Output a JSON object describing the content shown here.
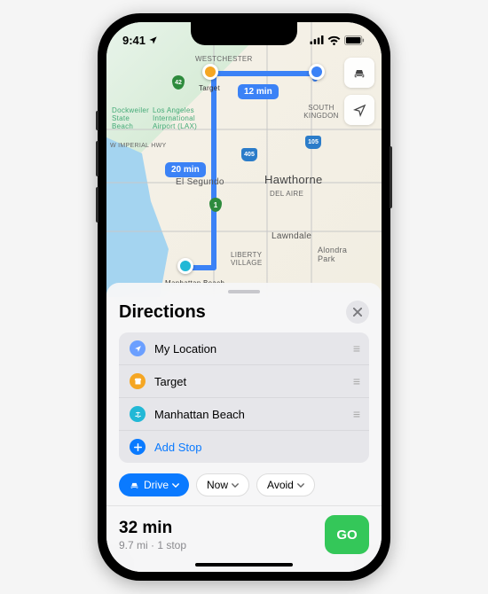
{
  "status": {
    "time": "9:41",
    "location_tracking": true
  },
  "map": {
    "route_badges": {
      "leg1": "12 min",
      "leg2": "20 min"
    },
    "stops": {
      "start_label": "Target",
      "end_label": "Manhattan Beach"
    },
    "city_labels": {
      "hawthorne": "Hawthorne",
      "del_aire": "DEL AIRE",
      "el_segundo": "El Segundo",
      "westchester": "WESTCHESTER",
      "lawndale": "Lawndale",
      "alondra": "Alondra Park",
      "liberty": "LIBERTY VILLAGE",
      "south_kingdon": "SOUTH KINGDON",
      "imperial": "W IMPERIAL HWY",
      "airport": "Los Angeles International Airport (LAX)",
      "dockweiler": "Dockweiler State Beach"
    },
    "highways": {
      "i405": "405",
      "i105": "105",
      "ca1": "1",
      "ca42": "42"
    }
  },
  "sheet": {
    "title": "Directions",
    "stops": [
      {
        "label": "My Location",
        "icon": "location",
        "color": "#6b9fff",
        "draggable": true
      },
      {
        "label": "Target",
        "icon": "store",
        "color": "#f5a623",
        "draggable": true
      },
      {
        "label": "Manhattan Beach",
        "icon": "beach",
        "color": "#22b8d6",
        "draggable": true
      },
      {
        "label": "Add Stop",
        "icon": "plus",
        "color": "#0a7aff",
        "draggable": false
      }
    ],
    "options": {
      "mode": "Drive",
      "time": "Now",
      "avoid": "Avoid"
    },
    "summary": {
      "time": "32 min",
      "sub": "9.7 mi · 1 stop",
      "go": "GO"
    }
  }
}
